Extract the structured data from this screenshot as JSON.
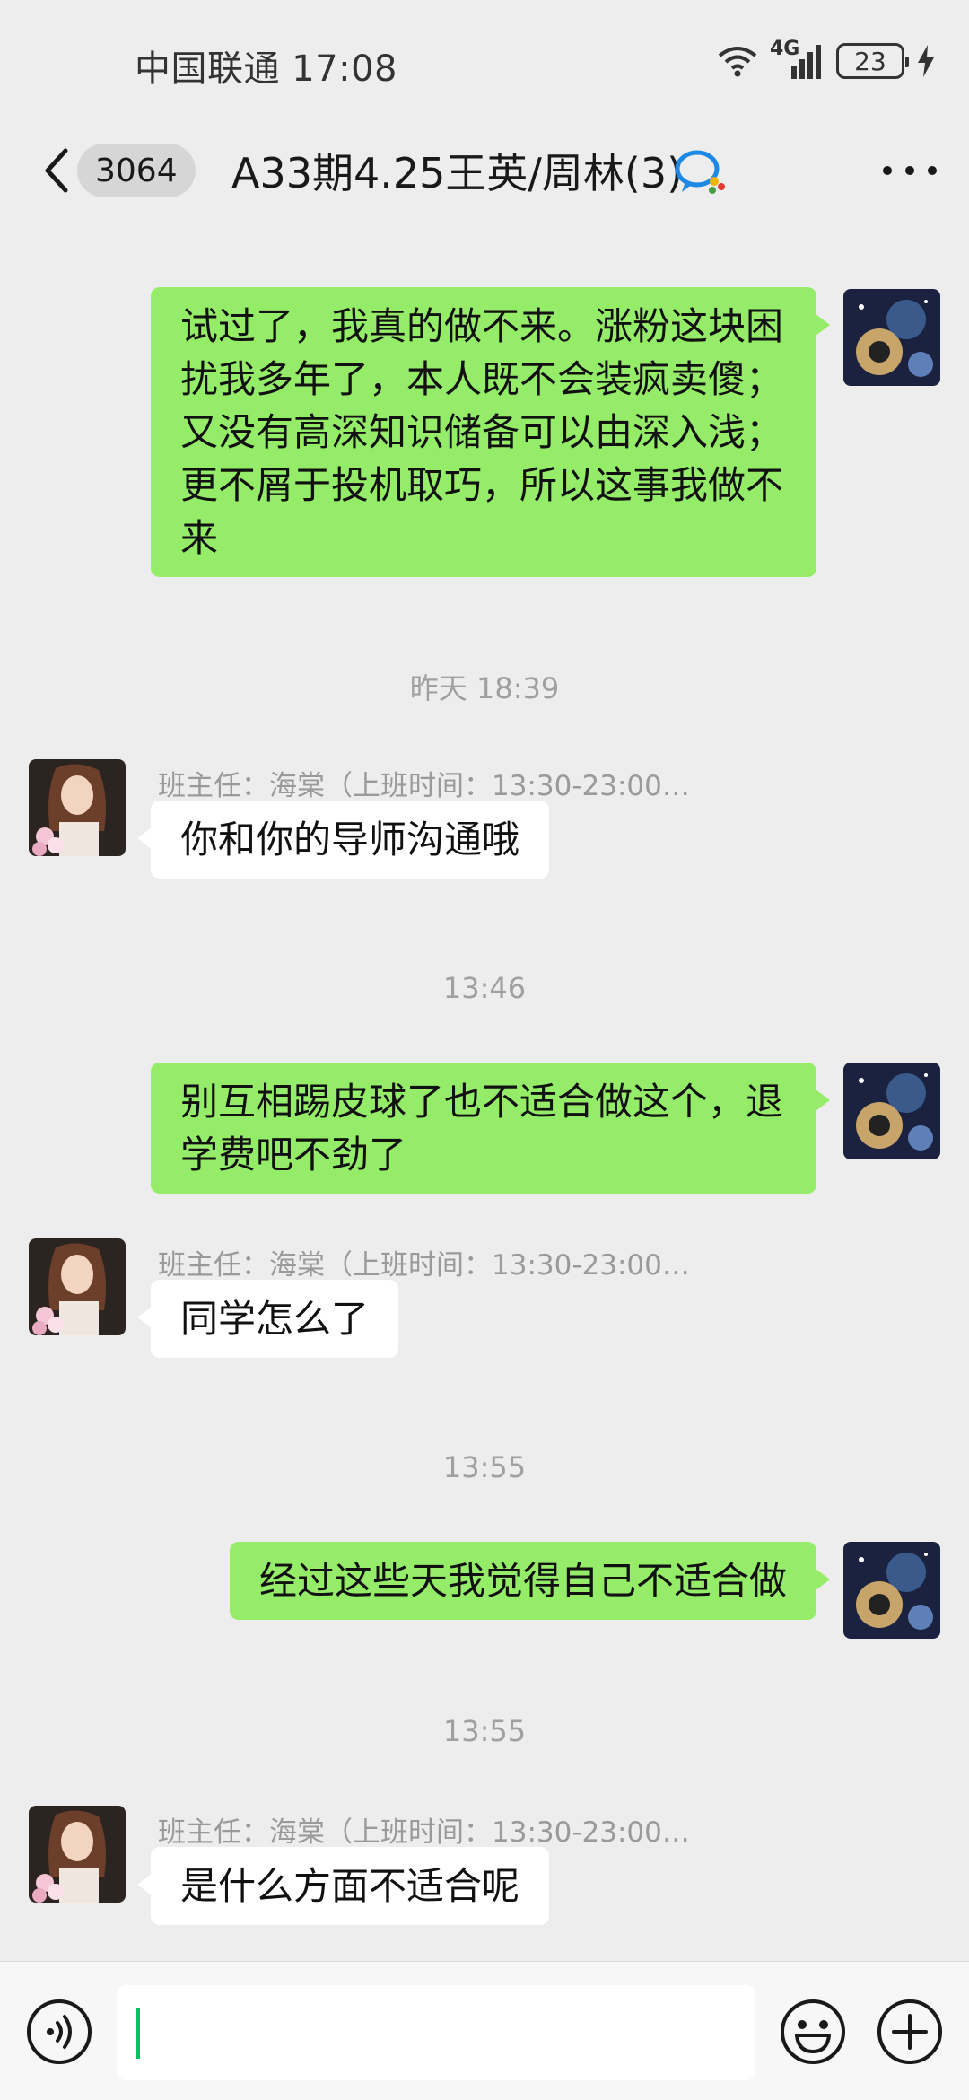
{
  "status_bar": {
    "carrier_time": "中国联通 17:08",
    "network": "4G",
    "battery": "23"
  },
  "header": {
    "unread_count": "3064",
    "title": "A33期4.25王英/周林(3)"
  },
  "messages": [
    {
      "type": "message",
      "from": "me",
      "text": "试过了，我真的做不来。涨粉这块困扰我多年了，本人既不会装疯卖傻；又没有高深知识储备可以由深入浅；更不屑于投机取巧，所以这事我做不来"
    },
    {
      "type": "time",
      "text": "昨天 18:39"
    },
    {
      "type": "message",
      "from": "other",
      "sender": "班主任：海棠（上班时间：13:30-23:00…",
      "text": "你和你的导师沟通哦"
    },
    {
      "type": "time",
      "text": "13:46"
    },
    {
      "type": "message",
      "from": "me",
      "text": "别互相踢皮球了也不适合做这个，退学费吧不劲了"
    },
    {
      "type": "message",
      "from": "other",
      "sender": "班主任：海棠（上班时间：13:30-23:00…",
      "text": "同学怎么了"
    },
    {
      "type": "time",
      "text": "13:55"
    },
    {
      "type": "message",
      "from": "me",
      "text": "经过这些天我觉得自己不适合做"
    },
    {
      "type": "time",
      "text": "13:55"
    },
    {
      "type": "message",
      "from": "other",
      "sender": "班主任：海棠（上班时间：13:30-23:00…",
      "text": "是什么方面不适合呢"
    }
  ],
  "input": {
    "value": ""
  },
  "colors": {
    "my_bubble": "#95ec69",
    "other_bubble": "#ffffff",
    "background": "#ededed",
    "caret": "#07c160"
  }
}
